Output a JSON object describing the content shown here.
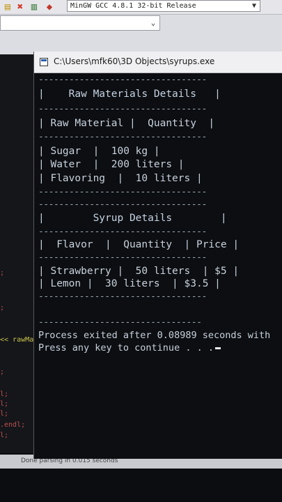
{
  "ide": {
    "compiler": "MinGW GCC 4.8.1 32-bit Release",
    "status": "Done parsing in 0.015 seconds",
    "editor_fragments": [
      ";",
      ";",
      "<< rawMat",
      ";",
      "l;",
      "l;",
      "l;",
      ".endl;",
      "l;"
    ]
  },
  "console": {
    "title": "C:\\Users\\mfk60\\3D Objects\\syrups.exe",
    "lines": [
      "---------------------------------",
      "|    Raw Materials Details   |",
      "---------------------------------",
      "| Raw Material |  Quantity  |",
      "---------------------------------",
      "| Sugar  |  100 kg |",
      "| Water  |  200 liters |",
      "| Flavoring  |  10 liters |",
      "---------------------------------",
      "---------------------------------",
      "|        Syrup Details        |",
      "---------------------------------",
      "|  Flavor  |  Quantity  | Price |",
      "---------------------------------",
      "| Strawberry |  50 liters  | $5 |",
      "| Lemon |  30 liters  | $3.5 |",
      "---------------------------------",
      "--------------------------------",
      "Process exited after 0.08989 seconds with",
      "Press any key to continue . . ."
    ]
  },
  "colors": {
    "console_bg": "#0c0e11",
    "console_text": "#c8d2de",
    "titlebar": "#f0f0f2"
  }
}
